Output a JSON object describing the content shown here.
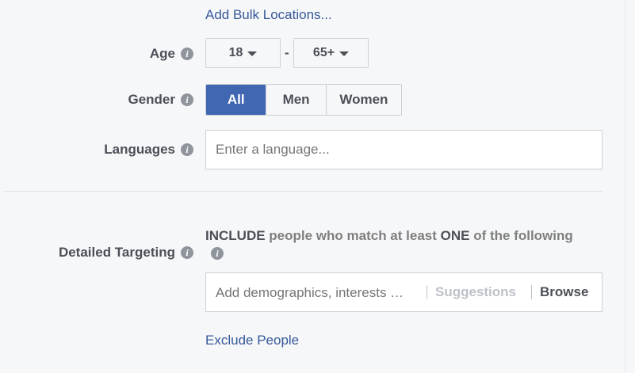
{
  "add_bulk_locations": "Add Bulk Locations...",
  "age": {
    "label": "Age",
    "min": "18",
    "max": "65+",
    "separator": "-"
  },
  "gender": {
    "label": "Gender",
    "options": [
      "All",
      "Men",
      "Women"
    ],
    "selected": "All"
  },
  "languages": {
    "label": "Languages",
    "placeholder": "Enter a language..."
  },
  "detailed_targeting": {
    "label": "Detailed Targeting",
    "include_keyword": "INCLUDE",
    "include_middle": " people who match at least ",
    "include_one": "ONE",
    "include_end": " of the following",
    "search_placeholder": "Add demographics, interests …",
    "suggestions_label": "Suggestions",
    "browse_label": "Browse"
  },
  "exclude_people": "Exclude People",
  "icons": {
    "info": "info-icon",
    "caret": "caret-down-icon"
  },
  "colors": {
    "accent": "#4267b2",
    "link": "#365899",
    "text": "#4b4f56",
    "muted": "#90949c"
  }
}
